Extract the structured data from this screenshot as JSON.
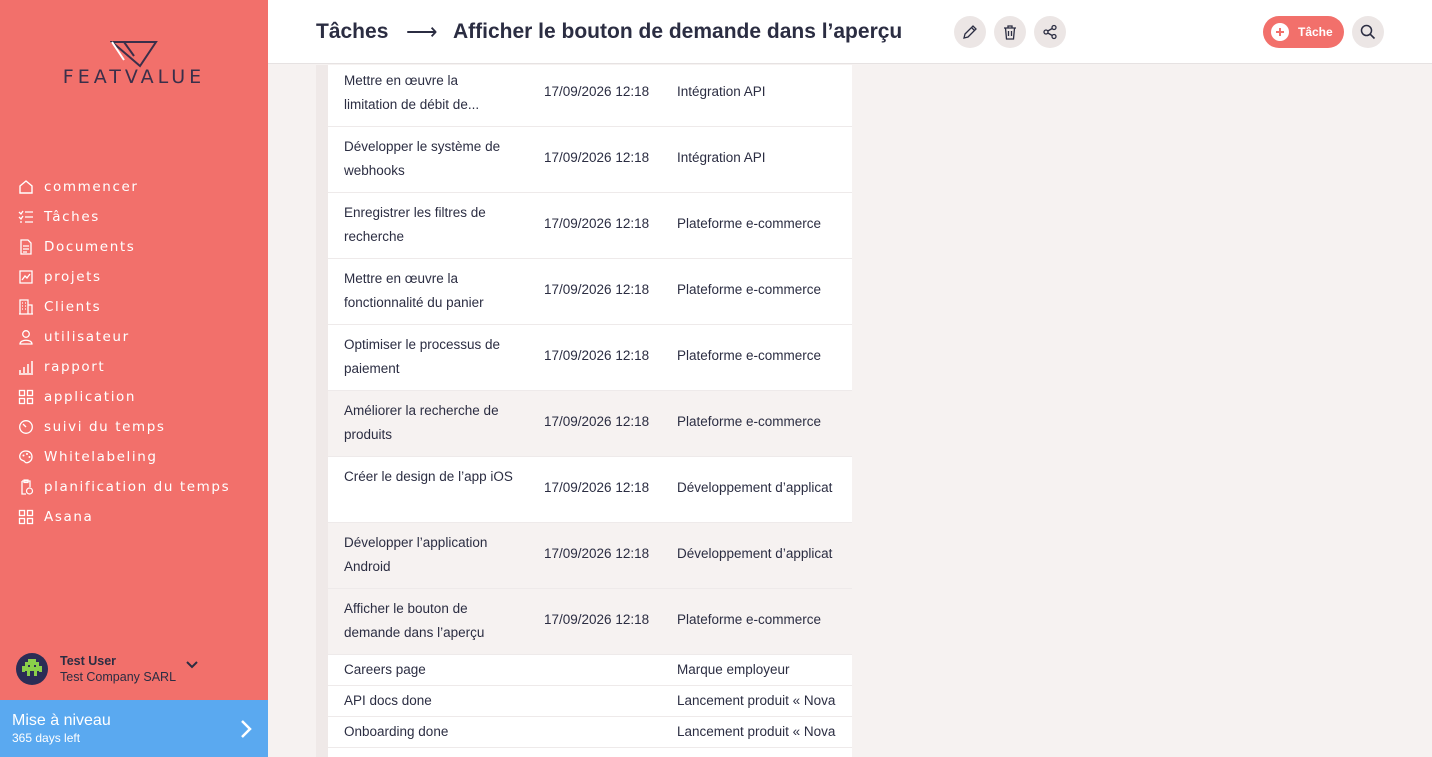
{
  "sidebar": {
    "logo_text": "FEATVALUE",
    "items": [
      {
        "label": "commencer",
        "icon": "home-icon"
      },
      {
        "label": "Tâches",
        "icon": "checklist-icon"
      },
      {
        "label": "Documents",
        "icon": "document-icon"
      },
      {
        "label": "projets",
        "icon": "chart-icon"
      },
      {
        "label": "Clients",
        "icon": "building-icon"
      },
      {
        "label": "utilisateur",
        "icon": "user-icon"
      },
      {
        "label": "rapport",
        "icon": "bar-chart-icon"
      },
      {
        "label": "application",
        "icon": "apps-icon"
      },
      {
        "label": "suivi du temps",
        "icon": "timer-icon"
      },
      {
        "label": "Whitelabeling",
        "icon": "palette-icon"
      },
      {
        "label": "planification du temps",
        "icon": "clipboard-clock-icon"
      },
      {
        "label": "Asana",
        "icon": "apps-icon"
      }
    ],
    "user": {
      "name": "Test User",
      "company": "Test Company SARL"
    },
    "upgrade": {
      "title": "Mise à niveau",
      "subtitle": "365 days left"
    }
  },
  "header": {
    "breadcrumb_root": "Tâches",
    "breadcrumb_arrow": "⟶",
    "title": "Afficher le bouton de demande dans l’aperçu",
    "task_button_label": "Tâche"
  },
  "colors": {
    "accent": "#f2706b",
    "upgrade": "#5aa9f0",
    "text": "#2b2d42"
  },
  "tasks": [
    {
      "name": "Mettre en œuvre la limitation de débit de...",
      "date": "17/09/2026 12:18",
      "project": "Intégration API"
    },
    {
      "name": "Développer le système de webhooks",
      "date": "17/09/2026 12:18",
      "project": "Intégration API"
    },
    {
      "name": "Enregistrer les filtres de recherche",
      "date": "17/09/2026 12:18",
      "project": "Plateforme e-commerce"
    },
    {
      "name": "Mettre en œuvre la fonctionnalité du panier",
      "date": "17/09/2026 12:18",
      "project": "Plateforme e-commerce"
    },
    {
      "name": "Optimiser le processus de paiement",
      "date": "17/09/2026 12:18",
      "project": "Plateforme e-commerce"
    },
    {
      "name": "Améliorer la recherche de produits",
      "date": "17/09/2026 12:18",
      "project": "Plateforme e-commerce"
    },
    {
      "name": "Créer le design de l’app iOS",
      "date": "17/09/2026 12:18",
      "project": "Développement d’applicat"
    },
    {
      "name": "Développer l’application Android",
      "date": "17/09/2026 12:18",
      "project": "Développement d’applicat"
    },
    {
      "name": "Afficher le bouton de demande dans l’aperçu",
      "date": "17/09/2026 12:18",
      "project": "Plateforme e-commerce"
    },
    {
      "name": "Careers page",
      "date": "",
      "project": "Marque employeur"
    },
    {
      "name": "API docs done",
      "date": "",
      "project": "Lancement produit « Nova"
    },
    {
      "name": "Onboarding done",
      "date": "",
      "project": "Lancement produit « Nova"
    }
  ]
}
